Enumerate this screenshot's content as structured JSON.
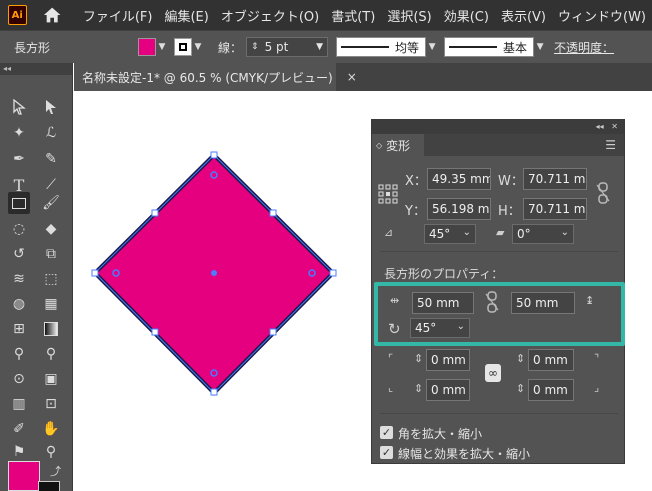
{
  "app": {
    "logo": "Ai",
    "home_icon": "home-icon"
  },
  "menu": [
    "ファイル(F)",
    "編集(E)",
    "オブジェクト(O)",
    "書式(T)",
    "選択(S)",
    "効果(C)",
    "表示(V)",
    "ウィンドウ(W)"
  ],
  "control": {
    "shape_label": "長方形",
    "stroke_label": "線：",
    "stroke_value": "5 pt",
    "profile_label": "均等",
    "brush_label": "基本",
    "opacity_label": "不透明度："
  },
  "colors": {
    "fill": "#e4007f",
    "accent_highlight": "#33b7a6"
  },
  "document": {
    "tab_title": "名称未設定-1* @ 60.5 % (CMYK/プレビュー)",
    "close_icon": "close-icon"
  },
  "transform": {
    "tab": "変形",
    "x_label": "X：",
    "x_value": "49.35 mm",
    "y_label": "Y：",
    "y_value": "56.198 mm",
    "w_label": "W：",
    "w_value": "70.711 mm",
    "h_label": "H：",
    "h_value": "70.711 mm",
    "angle_value": "45°",
    "shear_value": "0°",
    "rect_props_label": "長方形のプロパティ：",
    "rect_width": "50 mm",
    "rect_height": "50 mm",
    "rect_angle": "45°",
    "corner_tl": "0 mm",
    "corner_tr": "0 mm",
    "corner_bl": "0 mm",
    "corner_br": "0 mm",
    "scale_corners": "角を拡大・縮小",
    "scale_strokes": "線幅と効果を拡大・縮小"
  }
}
